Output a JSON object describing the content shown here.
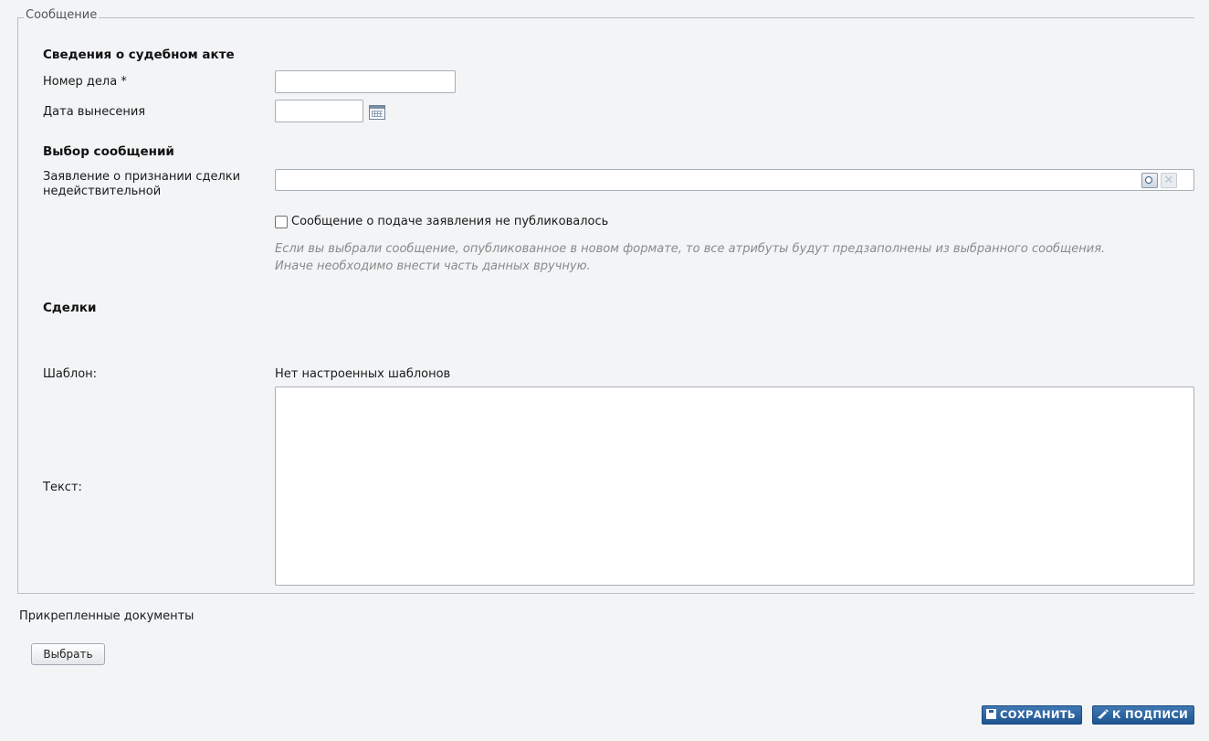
{
  "form": {
    "legend": "Сообщение",
    "court_act": {
      "title": "Сведения о судебном акте",
      "case_number_label": "Номер дела *",
      "case_number_value": "",
      "date_label": "Дата вынесения",
      "date_value": ""
    },
    "messages": {
      "title": "Выбор сообщений",
      "statement_label_line1": "Заявление о признании сделки",
      "statement_label_line2": "недействительной",
      "statement_value": "",
      "not_published_label": "Сообщение о подаче заявления не публиковалось",
      "not_published_checked": false,
      "hint_line1": "Если вы выбрали сообщение, опубликованное в новом формате, то все атрибуты будут предзаполнены из выбранного сообщения.",
      "hint_line2": "Иначе необходимо внести часть данных вручную."
    },
    "deals": {
      "title": "Сделки"
    },
    "template": {
      "label": "Шаблон:",
      "value": "Нет настроенных шаблонов"
    },
    "text": {
      "label": "Текст:",
      "value": ""
    }
  },
  "attachments": {
    "title": "Прикрепленные документы",
    "choose_button": "Выбрать"
  },
  "actions": {
    "save_label": "СОХРАНИТЬ",
    "save_icon": "floppy-disk-icon",
    "sign_label": "К ПОДПИСИ",
    "sign_icon": "pen-icon",
    "button_color": "#2a67a6"
  }
}
